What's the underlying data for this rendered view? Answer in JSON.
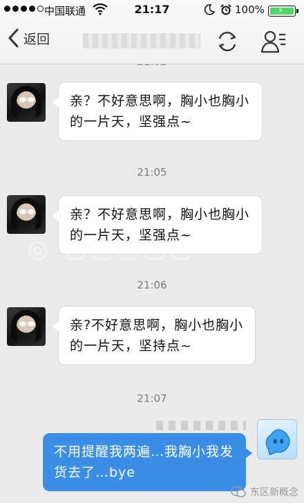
{
  "status_bar": {
    "carrier": "中国联通",
    "time": "21:17",
    "battery_percent": "100%",
    "battery_level": 1.0,
    "signal_bars_filled": 4,
    "signal_bars_total": 5
  },
  "nav": {
    "back_label": "返回",
    "title": "",
    "icons": [
      "chevron-left-icon",
      "refresh-icon",
      "profile-list-icon"
    ]
  },
  "messages": [
    {
      "sender": "contact",
      "text": "亲？不好意思啊，胸小也胸小的一片天，坚强点~"
    },
    {
      "type": "timestamp",
      "text": "21:05"
    },
    {
      "sender": "contact",
      "text": "亲？不好意思啊，胸小也胸小的一片天，坚强点~"
    },
    {
      "type": "timestamp",
      "text": "21:06"
    },
    {
      "sender": "contact",
      "text": "亲?不好意思啊，胸小也胸小的一片天，坚持点~"
    },
    {
      "type": "timestamp",
      "text": "21:07"
    },
    {
      "sender": "me",
      "text": "不用提醒我两遍…我胸小我发货去了…bye"
    }
  ],
  "watermark": {
    "source": "东区新概念"
  },
  "colors": {
    "outgoing_bubble": "#3a8ee6",
    "incoming_bubble": "#ffffff",
    "chat_background": "#ebebeb",
    "battery_fill": "#4cd964"
  }
}
